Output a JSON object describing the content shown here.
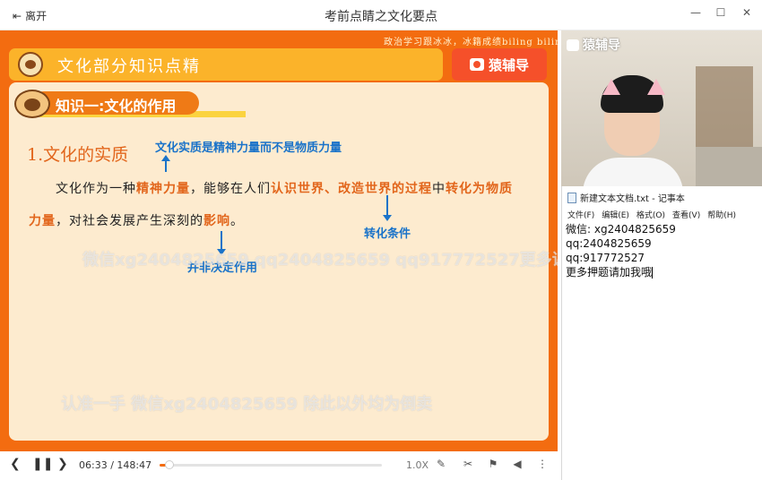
{
  "window": {
    "title": "考前点睛之文化要点",
    "leave_label": "离开",
    "minimize_icon": "minimize-icon",
    "maximize_icon": "maximize-icon",
    "close_icon": "close-icon"
  },
  "slide": {
    "top_slogan": "政治学习跟冰冰，冰籍成绩biling biling",
    "banner_title": "文化部分知识点精",
    "brand": "猿辅导",
    "knowledge_title": "知识一:文化的作用",
    "section_title": "1.文化的实质",
    "annotation_top": "文化实质是精神力量而不是物质力量",
    "annotation_right": "转化条件",
    "annotation_bottom": "并非决定作用",
    "para1": {
      "a": "文化作为一种",
      "b": "精神力量",
      "c": "，能够在人们",
      "d": "认识世界、改造世界的过程",
      "e": "中",
      "f": "转化为物质"
    },
    "para2": {
      "a": "力量",
      "b": "，对社会发展产生深刻的",
      "c": "影响",
      "d": "。"
    },
    "watermark1": "微信xg2404825659 qq2404825659 qq917772527更多课程",
    "watermark2": "认准一手  微信xg2404825659 除此以外均为倒卖"
  },
  "player": {
    "current_time": "06:33",
    "total_time": "/ 148:47",
    "progress": 0.044,
    "speed": "1.0X",
    "accent": "#f36c10"
  },
  "webcam": {
    "brand": "猿辅导"
  },
  "notepad": {
    "title": "新建文本文档.txt - 记事本",
    "menu": [
      "文件(F)",
      "编辑(E)",
      "格式(O)",
      "查看(V)",
      "帮助(H)"
    ],
    "lines": [
      "微信: xg2404825659",
      "qq:2404825659",
      "qq:917772527",
      "更多押题请加我哦"
    ]
  }
}
